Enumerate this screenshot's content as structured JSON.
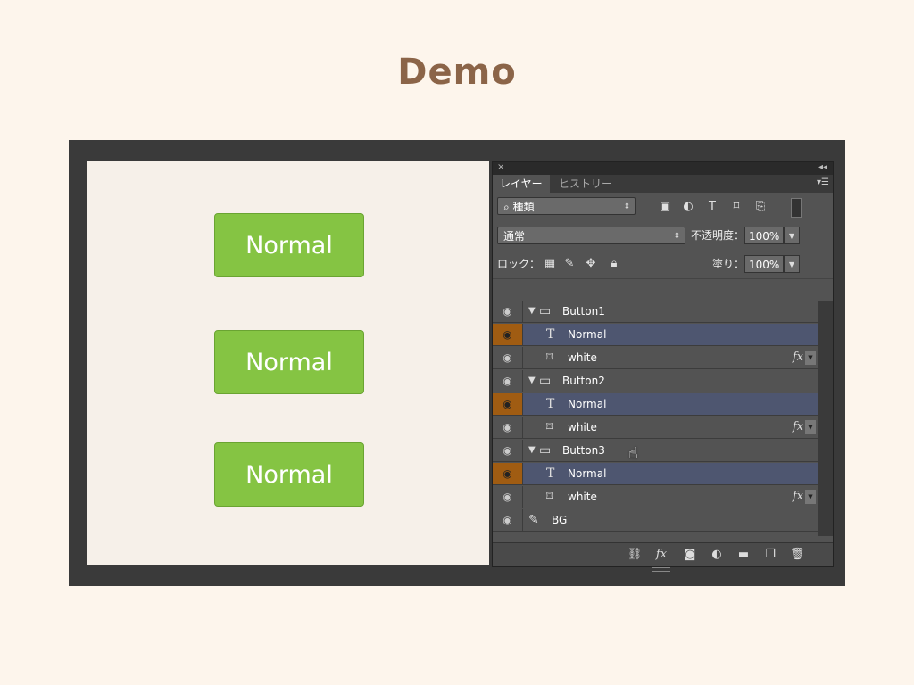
{
  "slide": {
    "title": "Demo"
  },
  "canvas": {
    "buttons": [
      {
        "label": "Normal"
      },
      {
        "label": "Normal"
      },
      {
        "label": "Normal"
      }
    ]
  },
  "panel": {
    "close": "×",
    "collapse": "◂◂",
    "menu": "▾☰",
    "tabs": [
      {
        "label": "レイヤー"
      },
      {
        "label": "ヒストリー"
      }
    ],
    "filter": {
      "label": "種類",
      "arrow": "⇕"
    },
    "blend_mode": {
      "value": "通常",
      "arrow": "⇕"
    },
    "opacity": {
      "label": "不透明度：",
      "value": "100%"
    },
    "fill": {
      "label": "塗り：",
      "value": "100%"
    },
    "lock": {
      "label": "ロック："
    },
    "layers": [
      {
        "name": "Button1",
        "kind": "group",
        "eye": "◉",
        "icon": "folder-icon"
      },
      {
        "name": "Normal",
        "kind": "text",
        "eye": "◉",
        "icon": "text-layer-icon"
      },
      {
        "name": "white",
        "kind": "shape",
        "eye": "◉",
        "icon": "shape-layer-icon",
        "fx": "fx"
      },
      {
        "name": "Button2",
        "kind": "group",
        "eye": "◉",
        "icon": "folder-icon"
      },
      {
        "name": "Normal",
        "kind": "text",
        "eye": "◉",
        "icon": "text-layer-icon"
      },
      {
        "name": "white",
        "kind": "shape",
        "eye": "◉",
        "icon": "shape-layer-icon",
        "fx": "fx"
      },
      {
        "name": "Button3",
        "kind": "group",
        "eye": "◉",
        "icon": "folder-icon"
      },
      {
        "name": "Normal",
        "kind": "text",
        "eye": "◉",
        "icon": "text-layer-icon"
      },
      {
        "name": "white",
        "kind": "shape",
        "eye": "◉",
        "icon": "shape-layer-icon",
        "fx": "fx"
      },
      {
        "name": "BG",
        "kind": "paint",
        "eye": "◉",
        "icon": "brush-icon"
      }
    ],
    "bottom_icons": [
      "link-icon",
      "fx-icon",
      "mask-icon",
      "adjustment-icon",
      "new-group-icon",
      "new-layer-icon",
      "trash-icon"
    ],
    "bottom_fx": "fx"
  },
  "colors": {
    "background": "#fdf5ec",
    "title": "#8b6448",
    "button_green": "#85c443",
    "selected_row": "#4e5670",
    "eye_highlight": "#a05c12"
  }
}
